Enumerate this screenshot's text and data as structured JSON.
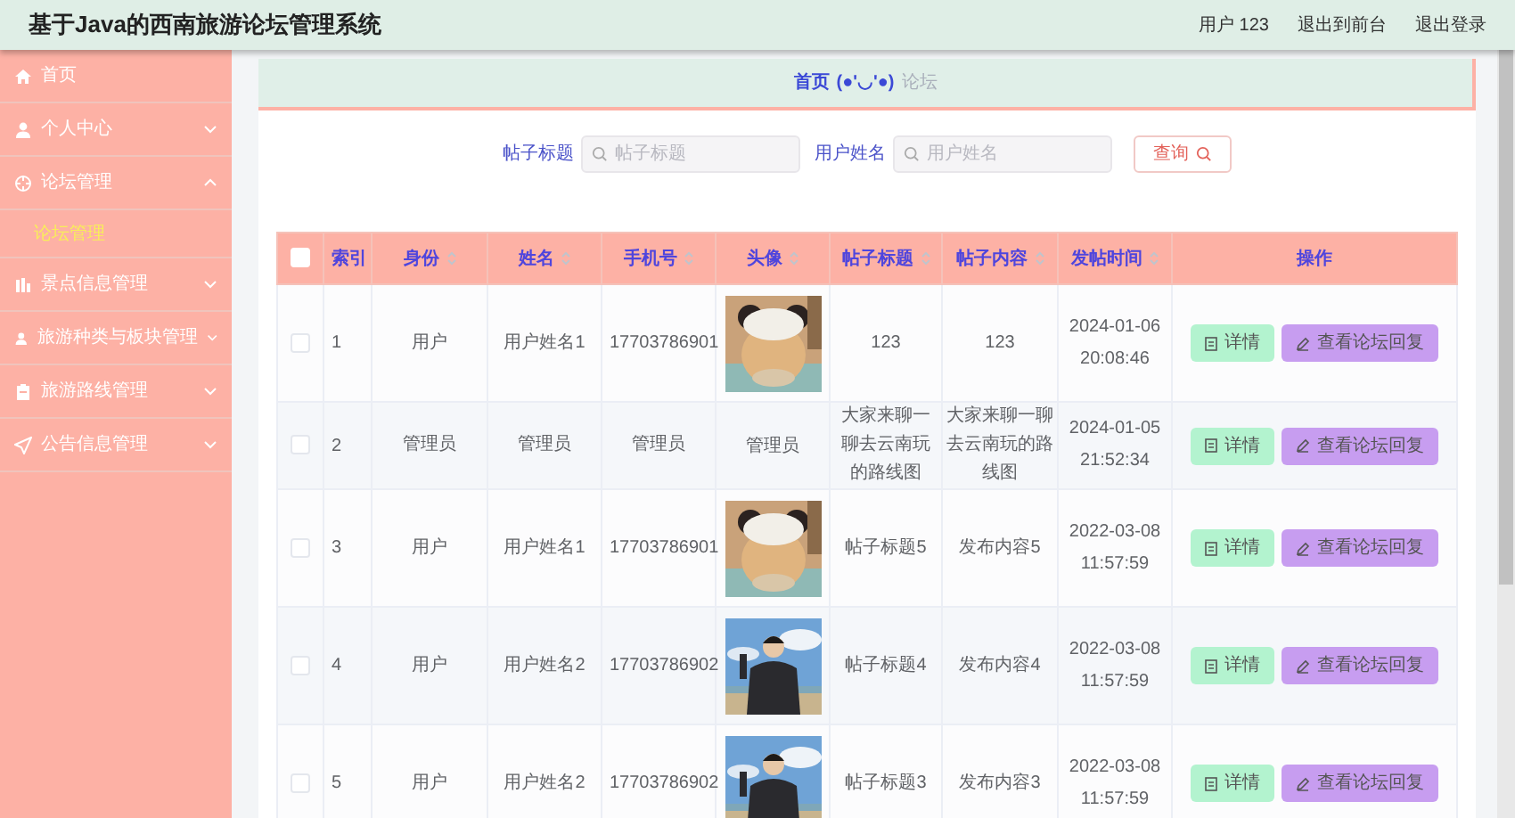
{
  "header": {
    "title": "基于Java的西南旅游论坛管理系统",
    "user": "用户 123",
    "links": [
      "退出到前台",
      "退出登录"
    ]
  },
  "sidebar": {
    "items": [
      {
        "kind": "link",
        "label": "首页"
      },
      {
        "kind": "menu",
        "label": "个人中心",
        "expanded": false
      },
      {
        "kind": "menu",
        "label": "论坛管理",
        "expanded": true,
        "children": [
          {
            "label": "论坛管理",
            "selected": true
          }
        ]
      },
      {
        "kind": "menu",
        "label": "景点信息管理",
        "expanded": false
      },
      {
        "kind": "menu",
        "label": "旅游种类与板块管理",
        "expanded": false
      },
      {
        "kind": "menu",
        "label": "旅游路线管理",
        "expanded": false
      },
      {
        "kind": "menu",
        "label": "公告信息管理",
        "expanded": false
      }
    ]
  },
  "breadcrumb": {
    "home": "首页",
    "separator": "(●'◡'●)",
    "current": "论坛"
  },
  "search": {
    "fields": [
      {
        "label": "帖子标题",
        "placeholder": "帖子标题"
      },
      {
        "label": "用户姓名",
        "placeholder": "用户姓名"
      }
    ],
    "button": "查询"
  },
  "table": {
    "select_all": false,
    "columns": [
      {
        "label": "索引",
        "sortable": false
      },
      {
        "label": "身份",
        "sortable": true
      },
      {
        "label": "姓名",
        "sortable": true
      },
      {
        "label": "手机号",
        "sortable": true
      },
      {
        "label": "头像",
        "sortable": true
      },
      {
        "label": "帖子标题",
        "sortable": true
      },
      {
        "label": "帖子内容",
        "sortable": true
      },
      {
        "label": "发帖时间",
        "sortable": true
      },
      {
        "label": "操作",
        "sortable": false
      }
    ],
    "rows": [
      {
        "checked": false,
        "index": "1",
        "role": "用户",
        "name": "用户姓名1",
        "phone": "17703786901",
        "title": "123",
        "content": "123",
        "time": "2024-01-06 20:08:46",
        "actions": [
          "详情",
          "查看论坛回复"
        ]
      },
      {
        "checked": false,
        "index": "2",
        "role": "管理员",
        "name": "管理员",
        "phone": "管理员",
        "avatar": {
          "kind": "text",
          "text": "管理员"
        },
        "title": "大家来聊一聊去云南玩的路线图",
        "content": "大家来聊一聊去云南玩的路线图",
        "time": "2024-01-05 21:52:34",
        "actions": [
          "详情",
          "查看论坛回复"
        ]
      },
      {
        "checked": false,
        "index": "3",
        "role": "用户",
        "name": "用户姓名1",
        "phone": "17703786901",
        "title": "帖子标题5",
        "content": "发布内容5",
        "time": "2022-03-08 11:57:59",
        "actions": [
          "详情",
          "查看论坛回复"
        ]
      },
      {
        "checked": false,
        "index": "4",
        "role": "用户",
        "name": "用户姓名2",
        "phone": "17703786902",
        "title": "帖子标题4",
        "content": "发布内容4",
        "time": "2022-03-08 11:57:59",
        "actions": [
          "详情",
          "查看论坛回复"
        ]
      },
      {
        "checked": false,
        "index": "5",
        "role": "用户",
        "name": "用户姓名2",
        "phone": "17703786902",
        "title": "帖子标题3",
        "content": "发布内容3",
        "time": "2022-03-08 11:57:59",
        "actions": [
          "详情",
          "查看论坛回复"
        ]
      }
    ]
  }
}
